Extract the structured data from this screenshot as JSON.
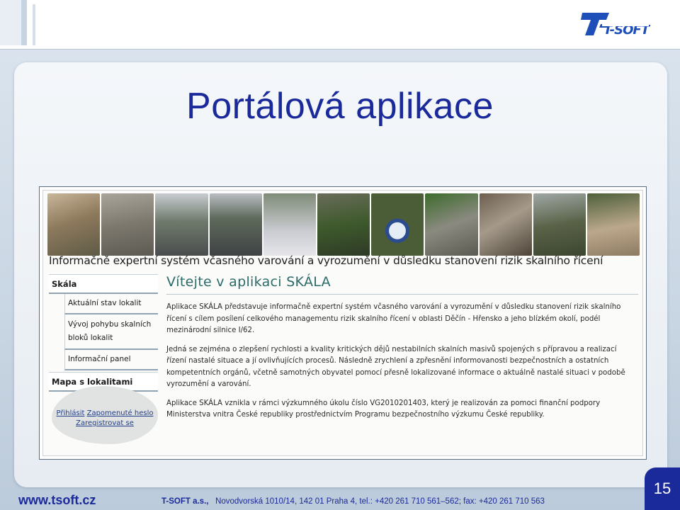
{
  "header": {
    "logo_text": "T-SOFT"
  },
  "slide": {
    "title": "Portálová aplikace"
  },
  "app": {
    "banner": "Informačně expertní systém včasného varování a vyrozumění v důsledku stanovení rizik skalního řícení",
    "sidebar": {
      "main1": "Skála",
      "sub1": "Aktuální stav lokalit",
      "sub2": "Vývoj pohybu skalních bloků lokalit",
      "sub3": "Informační panel",
      "main2": "Mapa s lokalitami"
    },
    "links": {
      "login": "Přihlásit",
      "forgot": "Zapomenuté heslo",
      "register": "Zaregistrovat se"
    },
    "content": {
      "title": "Vítejte v aplikaci SKÁLA",
      "p1": "Aplikace SKÁLA představuje informačně expertní systém včasného varování a vyrozumění v důsledku stanovení rizik skalního řícení s cílem posílení celkového managementu rizik skalního řícení v oblasti Děčín - Hřensko a jeho blízkém okolí, podél mezinárodní silnice I/62.",
      "p2": "Jedná se zejména o zlepšení rychlosti a kvality kritických dějů nestabilních skalních masivů spojených s přípravou a realizací řízení nastalé situace a jí ovlivňujících procesů. Následně zrychlení a zpřesnění informovanosti bezpečnostních a ostatních kompetentních orgánů, včetně samotných obyvatel pomocí přesně lokalizované informace o aktuálně nastalé situaci v podobě vyrozumění a varování.",
      "p3": "Aplikace SKÁLA vznikla v rámci výzkumného úkolu číslo VG2010201403, který je realizován za pomoci finanční podpory Ministerstva vnitra České republiky prostřednictvím Programu bezpečnostního výzkumu České republiky."
    }
  },
  "footer": {
    "url": "www.tsoft.cz",
    "company": "T-SOFT a.s.,",
    "address": "Novodvorská 1010/14, 142 01 Praha 4, tel.: +420 261 710 561–562; fax: +420 261 710 563",
    "page_number": "15"
  },
  "colors": {
    "title_blue": "#1b2a9a",
    "logo_blue": "#1e4fb8",
    "app_title_teal": "#2b6b68",
    "link_blue": "#1f3d8a"
  },
  "photos": [
    "rock-cliff",
    "rock-wall",
    "road-wet",
    "road-wet-2",
    "police-car",
    "rock-site",
    "road-sign",
    "mossy-rocks",
    "rock-face",
    "forest-rock",
    "rockfall-debris"
  ]
}
